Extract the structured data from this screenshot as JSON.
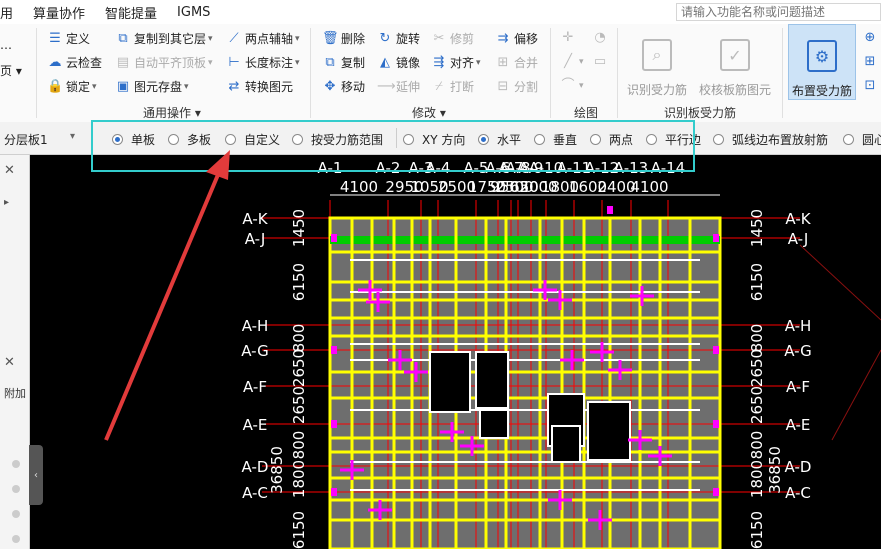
{
  "menubar": {
    "items": [
      "用",
      "算量协作",
      "智能提量",
      "IGMS"
    ]
  },
  "search": {
    "placeholder": "请输入功能名称或问题描述"
  },
  "ribbon": {
    "col0": {
      "row1": "…",
      "row2": "页 ▾"
    },
    "col1": {
      "define": "定义",
      "cloud_check": "云检查",
      "lock": "锁定"
    },
    "col2": {
      "copy_to_layer": "复制到其它层",
      "auto_flat_top": "自动平齐顶板",
      "elem_save": "图元存盘"
    },
    "col3": {
      "two_point_axis": "两点辅轴",
      "length_dim": "长度标注",
      "convert_elem": "转换图元"
    },
    "group_general": "通用操作",
    "col4": {
      "delete": "删除",
      "copy": "复制",
      "move": "移动"
    },
    "col5": {
      "rotate": "旋转",
      "mirror": "镜像",
      "extend": "延伸"
    },
    "col6": {
      "trim": "修剪",
      "align": "对齐",
      "break": "打断"
    },
    "col7": {
      "offset": "偏移",
      "merge": "合并",
      "split": "分割"
    },
    "group_modify": "修改",
    "group_draw": "绘图",
    "big1": "识别受力筋",
    "big2": "校核板筋图元",
    "big3": "布置受力筋",
    "group_recognize": "识别板受力筋"
  },
  "optbar": {
    "layer": "分层板1",
    "options": [
      {
        "label": "单板",
        "checked": true
      },
      {
        "label": "多板",
        "checked": false
      },
      {
        "label": "自定义",
        "checked": false
      },
      {
        "label": "按受力筋范围",
        "checked": false
      },
      {
        "label": "XY 方向",
        "checked": false
      },
      {
        "label": "水平",
        "checked": true
      },
      {
        "label": "垂直",
        "checked": false
      },
      {
        "label": "两点",
        "checked": false
      },
      {
        "label": "平行边",
        "checked": false
      },
      {
        "label": "弧线边布置放射筋",
        "checked": false
      },
      {
        "label": "圆心",
        "checked": false
      }
    ]
  },
  "leftpanel": {
    "label": "附加"
  },
  "cad": {
    "top_axes": [
      "A-1",
      "A-2",
      "A-3",
      "A-4",
      "A-5",
      "A-6",
      "A-7",
      "A-8",
      "A-9",
      "A-10",
      "A-11",
      "A-12",
      "A-13",
      "A-14"
    ],
    "top_dims": [
      "4100",
      "2950",
      "1050",
      "2500",
      "1750",
      "950",
      "2500",
      "650",
      "2000",
      "1800",
      "1600",
      "2400",
      "4100"
    ],
    "row_axes": [
      "A-K",
      "A-J",
      "A-H",
      "A-G",
      "A-F",
      "A-E",
      "A-D",
      "A-C"
    ],
    "left_dims": [
      "1450",
      "6150",
      "800",
      "2650",
      "2650",
      "800",
      "1800",
      "6150"
    ],
    "total_dim": "36850",
    "colors": {
      "outline": "#ffff00",
      "beam": "#ffffff",
      "rebar": "#ff00ff",
      "axis": "#ff0000",
      "green": "#00cc00",
      "fill": "#6e6e6e"
    }
  }
}
